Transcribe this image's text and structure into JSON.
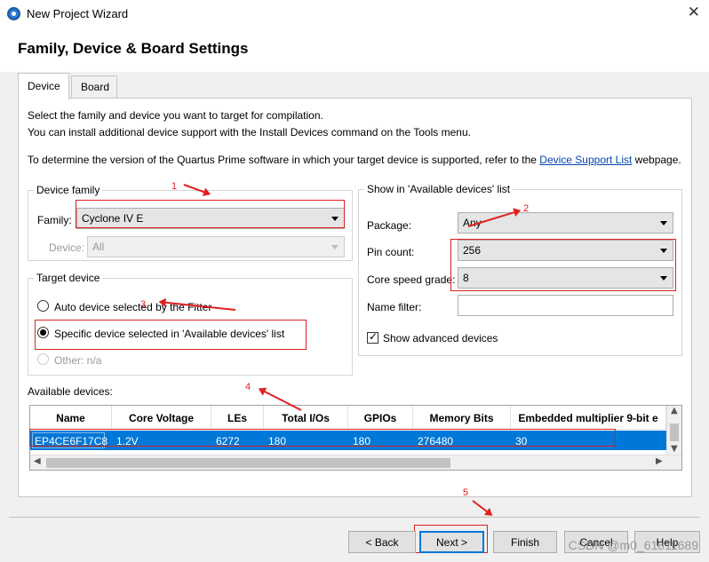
{
  "window": {
    "title": "New Project Wizard"
  },
  "page": {
    "title": "Family, Device & Board Settings"
  },
  "tabs": [
    {
      "label": "Device"
    },
    {
      "label": "Board"
    }
  ],
  "description": {
    "line1": "Select the family and device you want to target for compilation.",
    "line2": "You can install additional device support with the Install Devices command on the Tools menu.",
    "line3_prefix": "To determine the version of the Quartus Prime software in which your target device is supported, refer to the ",
    "line3_link": "Device Support List",
    "line3_suffix": " webpage."
  },
  "device_family": {
    "group_label": "Device family",
    "family_label": "Family:",
    "family_value": "Cyclone IV E",
    "device_label": "Device:",
    "device_value": "All"
  },
  "target_device": {
    "group_label": "Target device",
    "options": [
      {
        "label": "Auto device selected by the Fitter",
        "checked": false
      },
      {
        "label": "Specific device selected in 'Available devices' list",
        "checked": true
      },
      {
        "label": "Other:  n/a",
        "checked": false,
        "disabled": true
      }
    ]
  },
  "filters": {
    "group_label": "Show in 'Available devices' list",
    "package_label": "Package:",
    "package_value": "Any",
    "pin_count_label": "Pin count:",
    "pin_count_value": "256",
    "speed_grade_label": "Core speed grade:",
    "speed_grade_value": "8",
    "name_filter_label": "Name filter:",
    "name_filter_value": "",
    "show_advanced_label": "Show advanced devices",
    "show_advanced_checked": true
  },
  "available_devices": {
    "label": "Available devices:",
    "columns": [
      "Name",
      "Core Voltage",
      "LEs",
      "Total I/Os",
      "GPIOs",
      "Memory Bits",
      "Embedded multiplier 9-bit e"
    ],
    "rows": [
      [
        "EP4CE6F17C8",
        "1.2V",
        "6272",
        "180",
        "180",
        "276480",
        "30"
      ]
    ]
  },
  "annotations": [
    "1",
    "2",
    "3",
    "4",
    "5"
  ],
  "buttons": {
    "back": "< Back",
    "next": "Next >",
    "finish": "Finish",
    "cancel": "Cancel",
    "help": "Help"
  },
  "watermark": "CSDN @m0_61811689",
  "colors": {
    "selection": "#0078d7",
    "annotation": "#e02020",
    "link": "#0645ad"
  }
}
